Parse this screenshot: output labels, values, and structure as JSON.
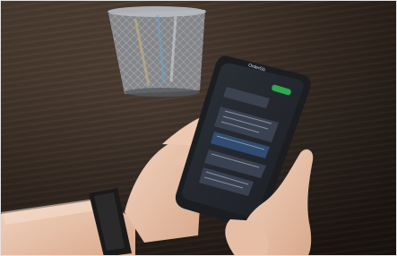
{
  "photo": {
    "description_tags": [
      "desk",
      "pencil-holder",
      "phone",
      "hands",
      "smartwatch"
    ]
  },
  "phone_screen": {
    "app_title": "OrderGb"
  },
  "colors": {
    "table": "#3f2f24",
    "phone_body": "#1b1d21",
    "screen": "#23272d",
    "accent_green": "#2fa84f",
    "skin": "#e9c4ad",
    "watch": "#1a1a1a"
  }
}
